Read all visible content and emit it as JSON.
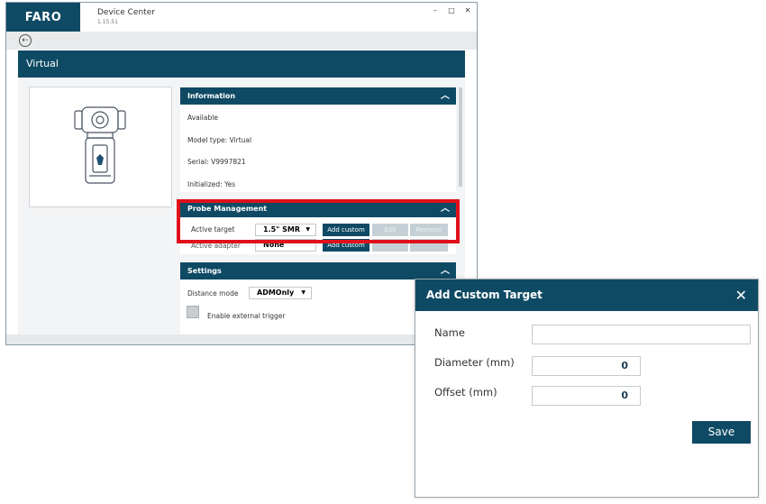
{
  "window": {
    "logo": "FARO",
    "title": "Device Center",
    "version": "1.15.51",
    "controls": {
      "minimize": "–",
      "maximize": "□",
      "close": "✕"
    }
  },
  "nav": {
    "back_icon": "⇠"
  },
  "device": {
    "name": "Virtual",
    "image_icon": "tracker-device-icon"
  },
  "information": {
    "header": "Information",
    "lines": [
      "Available",
      "Model type: Virtual",
      "Serial: V9997821",
      "Initialized: Yes"
    ]
  },
  "probe": {
    "header": "Probe Management",
    "active_target_label": "Active target",
    "active_target_value": "1.5\" SMR",
    "active_adapter_label": "Active adapter",
    "active_adapter_value": "None",
    "add_custom_label": "Add custom",
    "edit_label": "Edit",
    "remove_label": "Remove"
  },
  "settings": {
    "header": "Settings",
    "distance_mode_label": "Distance mode",
    "distance_mode_value": "ADMOnly",
    "external_trigger_label": "Enable external trigger"
  },
  "dialog": {
    "title": "Add Custom Target",
    "close_icon": "✕",
    "name_label": "Name",
    "name_value": "",
    "diameter_label": "Diameter (mm)",
    "diameter_value": "0",
    "offset_label": "Offset (mm)",
    "offset_value": "0",
    "save_label": "Save"
  },
  "colors": {
    "brand": "#0f4a64",
    "highlight": "#e0101a",
    "disabled_button": "#c5d0d6"
  }
}
